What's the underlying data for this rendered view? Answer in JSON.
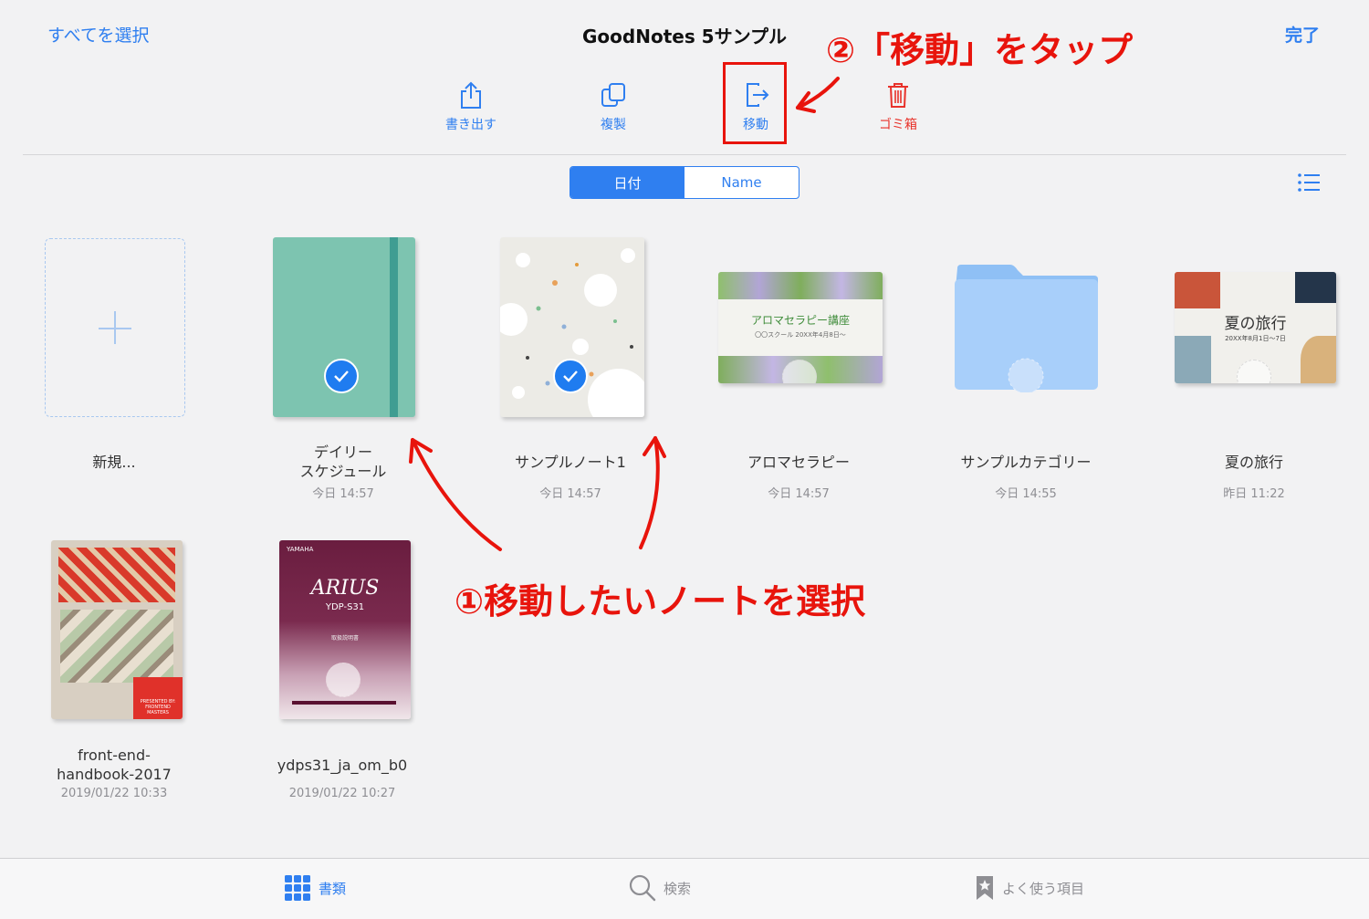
{
  "header": {
    "select_all": "すべてを選択",
    "title": "GoodNotes 5サンプル",
    "done": "完了"
  },
  "toolbar": {
    "export": "書き出す",
    "duplicate": "複製",
    "move": "移動",
    "trash": "ゴミ箱"
  },
  "sort": {
    "date": "日付",
    "name": "Name"
  },
  "items": [
    {
      "name": "新規..."
    },
    {
      "name_line1": "デイリー",
      "name_line2": "スケジュール",
      "date": "今日 14:57",
      "selected": true
    },
    {
      "name": "サンプルノート1",
      "date": "今日 14:57",
      "selected": true
    },
    {
      "name": "アロマセラピー",
      "date": "今日 14:57",
      "cover_text": "アロマセラピー講座",
      "cover_sub": "〇〇スクール 20XX年4月8日〜"
    },
    {
      "name": "サンプルカテゴリー",
      "date": "今日 14:55"
    },
    {
      "name": "夏の旅行",
      "date": "昨日 11:22",
      "cover_text": "夏の旅行",
      "cover_sub": "20XX年8月1日〜7日"
    },
    {
      "name_line1": "front-end-",
      "name_line2": "handbook-2017",
      "date": "2019/01/22 10:33",
      "cover_sub": "PRESENTED BY: FRONTEND MASTERS"
    },
    {
      "name": "ydps31_ja_om_b0",
      "date": "2019/01/22 10:27",
      "cover_brand": "YAMAHA",
      "cover_text": "ARIUS",
      "cover_sub": "YDP-S31",
      "cover_note": "取扱説明書"
    }
  ],
  "annotations": {
    "step1": "①移動したいノートを選択",
    "step2": "②「移動」をタップ"
  },
  "tabbar": {
    "documents": "書類",
    "search": "検索",
    "favorites": "よく使う項目"
  },
  "colors": {
    "accent": "#2f7ff0",
    "destructive": "#e8322a",
    "annotation": "#e8140c"
  }
}
